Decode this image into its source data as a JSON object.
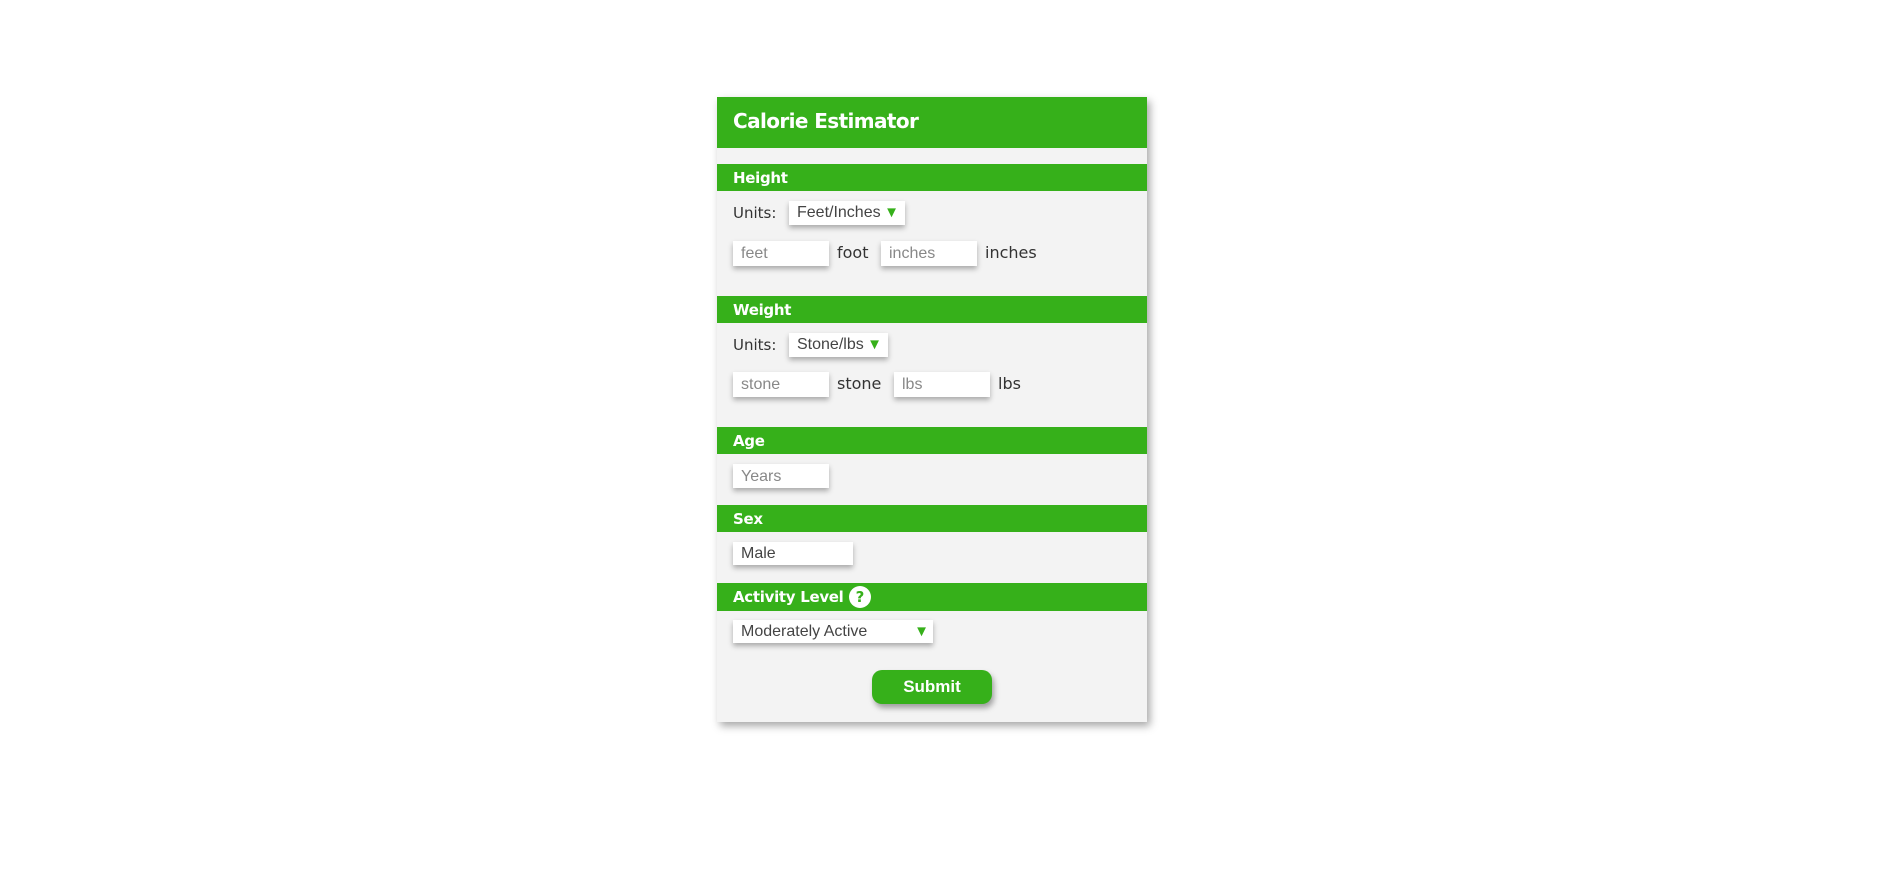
{
  "title": "Calorie Estimator",
  "colors": {
    "accent": "#36b01a",
    "panel": "#f3f3f3"
  },
  "height": {
    "header": "Height",
    "units_label": "Units:",
    "units_value": "Feet/Inches",
    "feet_placeholder": "feet",
    "feet_unit": "foot",
    "inches_placeholder": "inches",
    "inches_unit": "inches"
  },
  "weight": {
    "header": "Weight",
    "units_label": "Units:",
    "units_value": "Stone/lbs",
    "stone_placeholder": "stone",
    "stone_unit": "stone",
    "lbs_placeholder": "lbs",
    "lbs_unit": "lbs"
  },
  "age": {
    "header": "Age",
    "placeholder": "Years"
  },
  "sex": {
    "header": "Sex",
    "value": "Male"
  },
  "activity": {
    "header": "Activity Level",
    "help_icon": "?",
    "value": "Moderately Active"
  },
  "icons": {
    "dropdown_arrow": "▼",
    "help": "question-circle-icon"
  },
  "submit_label": "Submit"
}
